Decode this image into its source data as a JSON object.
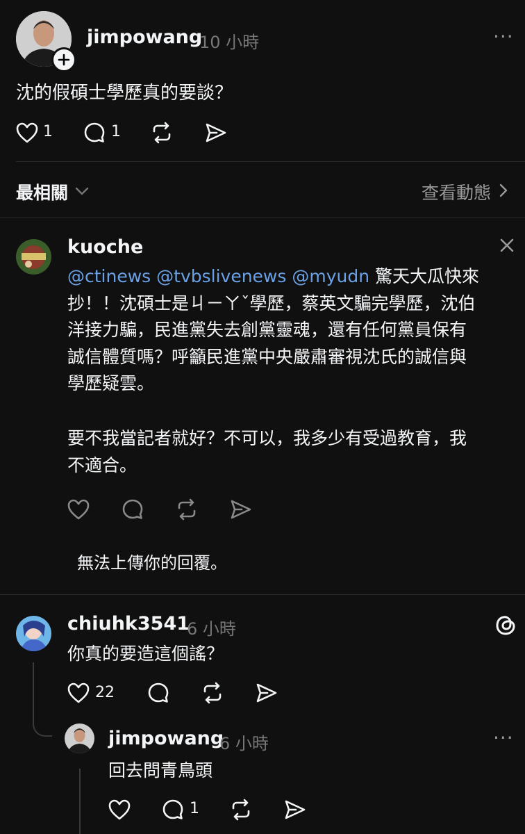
{
  "post": {
    "author": "jimpowang",
    "time": "10 小時",
    "text": "沈的假碩士學歷真的要談？",
    "likes": "1",
    "replies": "1"
  },
  "sort": {
    "label": "最相關",
    "view_activity": "查看動態"
  },
  "kuoche": {
    "author": "kuoche",
    "mentions": "@ctinews @tvbslivenews @myudn",
    "line1_rest": " 驚天大瓜快來",
    "line2": "抄！！沈碩士是ㄐㄧㄚˇ學歷，蔡英文騙完學歷，沈伯",
    "line3": "洋接力騙，民進黨失去創黨靈魂，還有任何黨員保有",
    "line4": "誠信體質嗎？呼籲民進黨中央嚴肅審視沈氏的誠信與",
    "line5": "學歷疑雲。",
    "para2_line1": "要不我當記者就好？不可以，我多少有受過教育，我",
    "para2_line2": "不適合。",
    "error": "無法上傳你的回覆。"
  },
  "chiuhk": {
    "author": "chiuhk3541",
    "time": "6 小時",
    "text": "你真的要造這個謠？",
    "likes": "22"
  },
  "reply": {
    "author": "jimpowang",
    "time": "6 小時",
    "text": "回去問青鳥頭",
    "replies": "1"
  },
  "colors": {
    "background": "#101010",
    "mention": "#6aa1e6",
    "muted": "#777777"
  }
}
